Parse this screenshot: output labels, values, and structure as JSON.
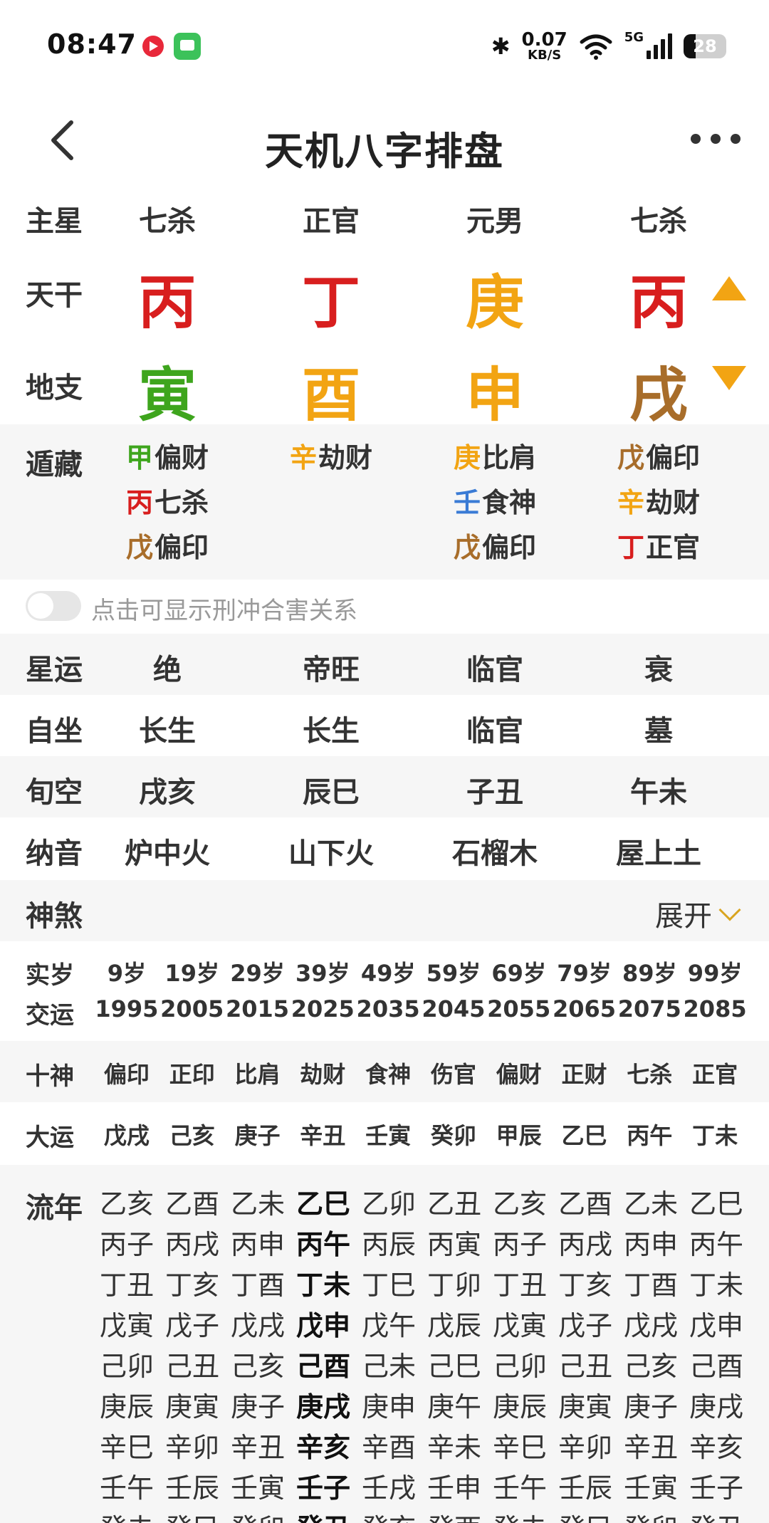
{
  "status_bar": {
    "time": "08:47",
    "speed_value": "0.07",
    "speed_unit": "KB/S",
    "network": "5G",
    "battery": "28"
  },
  "header": {
    "title": "天机八字排盘"
  },
  "pillars": {
    "main_star_label": "主星",
    "main_stars": [
      "七杀",
      "正官",
      "元男",
      "七杀"
    ],
    "stem_label": "天干",
    "stems": [
      {
        "char": "丙",
        "color": "#d81e1e"
      },
      {
        "char": "丁",
        "color": "#d81e1e"
      },
      {
        "char": "庚",
        "color": "#f2a413"
      },
      {
        "char": "丙",
        "color": "#d81e1e"
      }
    ],
    "branch_label": "地支",
    "branches": [
      {
        "char": "寅",
        "color": "#3ea51d"
      },
      {
        "char": "酉",
        "color": "#f2a413"
      },
      {
        "char": "申",
        "color": "#f2a413"
      },
      {
        "char": "戌",
        "color": "#a86d2a"
      }
    ]
  },
  "hidden_stems": {
    "label": "遁藏",
    "columns": [
      [
        {
          "stem": "甲",
          "god": "偏财",
          "color": "#3ea51d"
        },
        {
          "stem": "丙",
          "god": "七杀",
          "color": "#d81e1e"
        },
        {
          "stem": "戊",
          "god": "偏印",
          "color": "#a86d2a"
        }
      ],
      [
        {
          "stem": "辛",
          "god": "劫财",
          "color": "#f2a413"
        }
      ],
      [
        {
          "stem": "庚",
          "god": "比肩",
          "color": "#f2a413"
        },
        {
          "stem": "壬",
          "god": "食神",
          "color": "#3a7bd5"
        },
        {
          "stem": "戊",
          "god": "偏印",
          "color": "#a86d2a"
        }
      ],
      [
        {
          "stem": "戊",
          "god": "偏印",
          "color": "#a86d2a"
        },
        {
          "stem": "辛",
          "god": "劫财",
          "color": "#f2a413"
        },
        {
          "stem": "丁",
          "god": "正官",
          "color": "#d81e1e"
        }
      ]
    ]
  },
  "toggle": {
    "label": "点击可显示刑冲合害关系"
  },
  "info_rows": [
    {
      "label": "星运",
      "values": [
        "绝",
        "帝旺",
        "临官",
        "衰"
      ]
    },
    {
      "label": "自坐",
      "values": [
        "长生",
        "长生",
        "临官",
        "墓"
      ]
    },
    {
      "label": "旬空",
      "values": [
        "戌亥",
        "辰巳",
        "子丑",
        "午未"
      ]
    },
    {
      "label": "纳音",
      "values": [
        "炉中火",
        "山下火",
        "石榴木",
        "屋上土"
      ]
    }
  ],
  "shensha": {
    "label": "神煞",
    "expand_label": "展开"
  },
  "luck": {
    "age_label": "实岁",
    "ages": [
      "9岁",
      "19岁",
      "29岁",
      "39岁",
      "49岁",
      "59岁",
      "69岁",
      "79岁",
      "89岁",
      "99岁"
    ],
    "year_label": "交运",
    "years": [
      "1995",
      "2005",
      "2015",
      "2025",
      "2035",
      "2045",
      "2055",
      "2065",
      "2075",
      "2085"
    ],
    "ten_gods_label": "十神",
    "ten_gods": [
      "偏印",
      "正印",
      "比肩",
      "劫财",
      "食神",
      "伤官",
      "偏财",
      "正财",
      "七杀",
      "正官"
    ],
    "dayun_label": "大运",
    "dayun": [
      "戊戌",
      "己亥",
      "庚子",
      "辛丑",
      "壬寅",
      "癸卯",
      "甲辰",
      "乙巳",
      "丙午",
      "丁未"
    ]
  },
  "liunian": {
    "label": "流年",
    "current_column": 3,
    "rows": [
      [
        "乙亥",
        "乙酉",
        "乙未",
        "乙巳",
        "乙卯",
        "乙丑",
        "乙亥",
        "乙酉",
        "乙未",
        "乙巳"
      ],
      [
        "丙子",
        "丙戌",
        "丙申",
        "丙午",
        "丙辰",
        "丙寅",
        "丙子",
        "丙戌",
        "丙申",
        "丙午"
      ],
      [
        "丁丑",
        "丁亥",
        "丁酉",
        "丁未",
        "丁巳",
        "丁卯",
        "丁丑",
        "丁亥",
        "丁酉",
        "丁未"
      ],
      [
        "戊寅",
        "戊子",
        "戊戌",
        "戊申",
        "戊午",
        "戊辰",
        "戊寅",
        "戊子",
        "戊戌",
        "戊申"
      ],
      [
        "己卯",
        "己丑",
        "己亥",
        "己酉",
        "己未",
        "己巳",
        "己卯",
        "己丑",
        "己亥",
        "己酉"
      ],
      [
        "庚辰",
        "庚寅",
        "庚子",
        "庚戌",
        "庚申",
        "庚午",
        "庚辰",
        "庚寅",
        "庚子",
        "庚戌"
      ],
      [
        "辛巳",
        "辛卯",
        "辛丑",
        "辛亥",
        "辛酉",
        "辛未",
        "辛巳",
        "辛卯",
        "辛丑",
        "辛亥"
      ],
      [
        "壬午",
        "壬辰",
        "壬寅",
        "壬子",
        "壬戌",
        "壬申",
        "壬午",
        "壬辰",
        "壬寅",
        "壬子"
      ],
      [
        "癸未",
        "癸巳",
        "癸卯",
        "癸丑",
        "癸亥",
        "癸酉",
        "癸未",
        "癸巳",
        "癸卯",
        "癸丑"
      ]
    ]
  }
}
